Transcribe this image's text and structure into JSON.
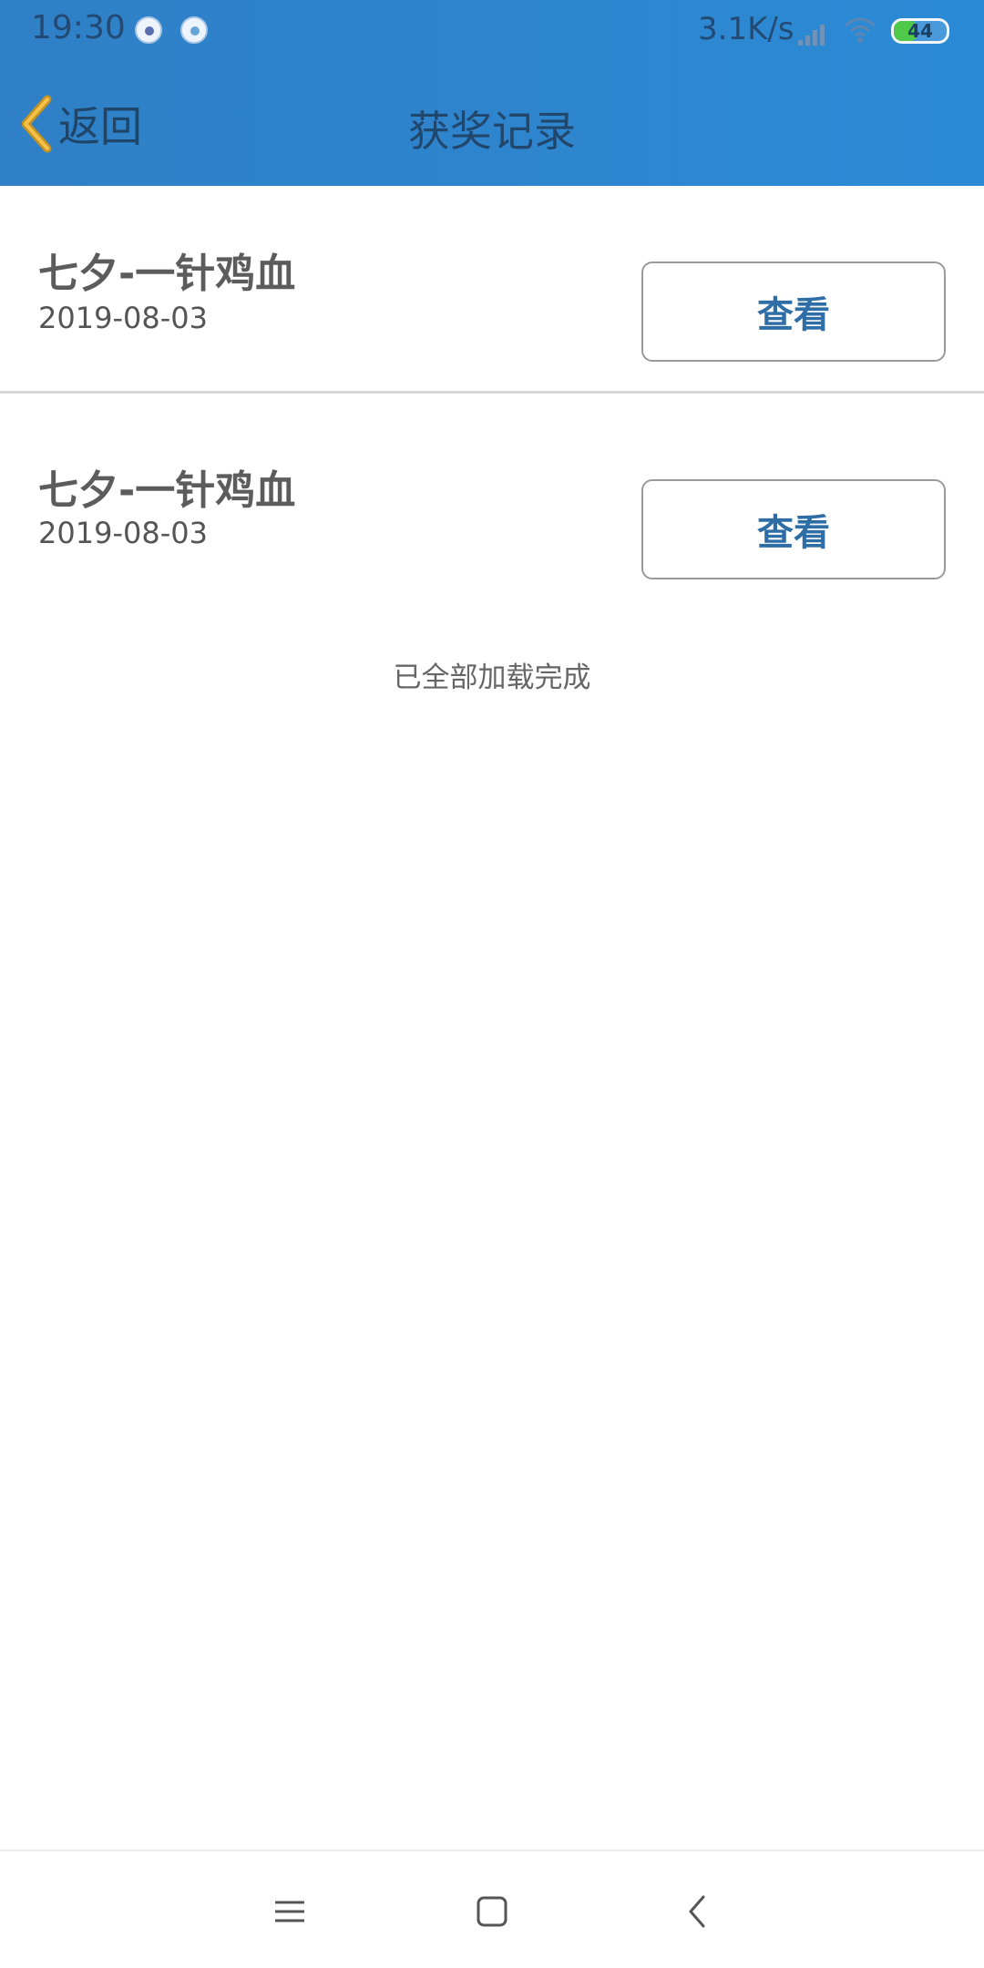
{
  "status_bar": {
    "time": "19:30",
    "network_speed": "3.1K/s",
    "battery_level": "44",
    "battery_fraction": 0.44,
    "icons": [
      "app-notification-icon",
      "app-notification-icon",
      "signal-icon",
      "wifi-icon",
      "battery-icon"
    ]
  },
  "header": {
    "back_label": "返回",
    "title": "获奖记录"
  },
  "records": [
    {
      "title": "七夕-一针鸡血",
      "date": "2019-08-03",
      "action_label": "查看"
    },
    {
      "title": "七夕-一针鸡血",
      "date": "2019-08-03",
      "action_label": "查看"
    }
  ],
  "load_status": "已全部加载完成",
  "nav_bar": {
    "icons": [
      "menu-icon",
      "home-icon",
      "back-icon"
    ]
  },
  "colors": {
    "header_blue": "#2e86cf",
    "action_text": "#2f6da6",
    "back_chevron": "#e0a020",
    "battery_green": "#50c84a"
  }
}
